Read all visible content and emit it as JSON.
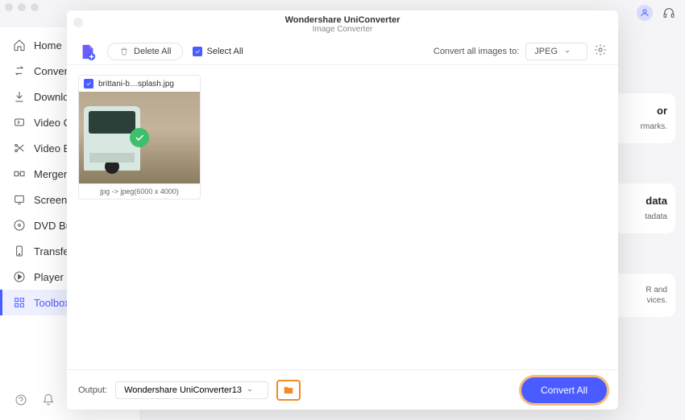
{
  "app": {
    "title": "Wondershare UniConverter"
  },
  "sidebar": {
    "items": [
      {
        "label": "Home"
      },
      {
        "label": "Convert"
      },
      {
        "label": "Downloa"
      },
      {
        "label": "Video C"
      },
      {
        "label": "Video E"
      },
      {
        "label": "Merger"
      },
      {
        "label": "Screen"
      },
      {
        "label": "DVD Bu"
      },
      {
        "label": "Transfer"
      },
      {
        "label": "Player"
      },
      {
        "label": "Toolbox"
      }
    ]
  },
  "peek": {
    "card1": {
      "title": "or",
      "desc": "rmarks."
    },
    "card2": {
      "title": "data",
      "desc": "tadata"
    },
    "card3": {
      "title": "",
      "desc1": "R and",
      "desc2": "vices."
    }
  },
  "modal": {
    "title": "Wondershare UniConverter",
    "subtitle": "Image Converter",
    "toolbar": {
      "delete_label": "Delete All",
      "select_all_label": "Select All",
      "convert_to_label": "Convert all images to:",
      "format": "JPEG"
    },
    "file": {
      "name": "brittani-b…splash.jpg",
      "status": "jpg -> jpeg(6000 x 4000)"
    },
    "bottom": {
      "output_label": "Output:",
      "output_path": "Wondershare UniConverter13",
      "convert_label": "Convert All"
    }
  }
}
